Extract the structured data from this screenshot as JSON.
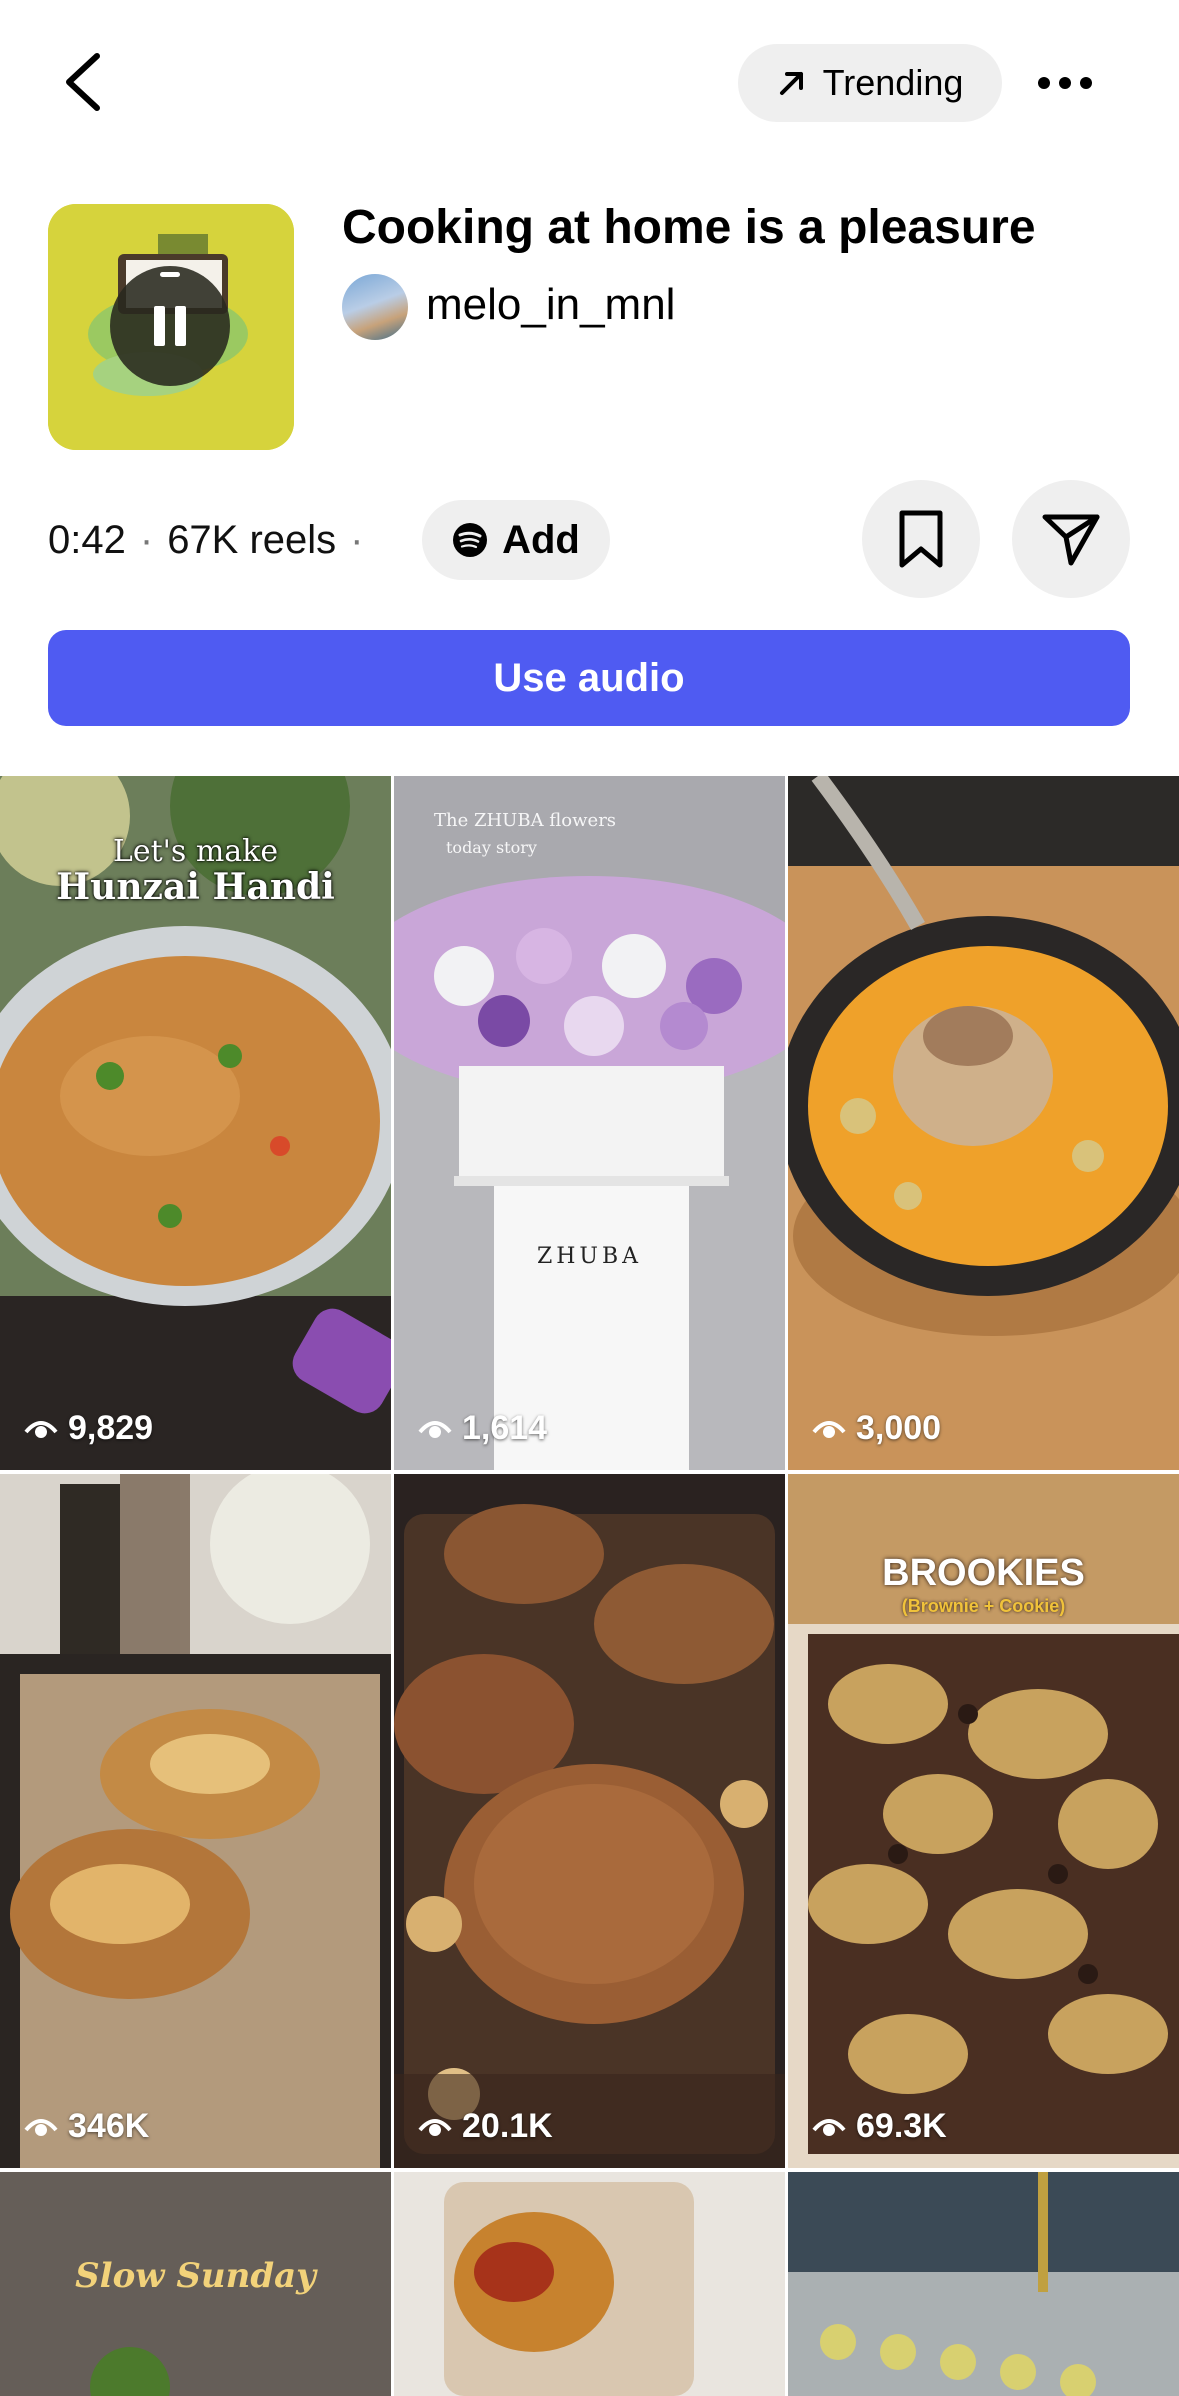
{
  "header": {
    "trending_label": "Trending"
  },
  "audio": {
    "title": "Cooking at home is a pleasure",
    "author": "melo_in_mnl",
    "duration": "0:42",
    "reels_count": "67K reels",
    "add_label": "Add",
    "use_audio_label": "Use audio"
  },
  "colors": {
    "accent": "#4f5bf2",
    "pill_bg": "#efefef"
  },
  "reels": [
    {
      "views": "9,829",
      "overlay_line1": "Let's make",
      "overlay_line2": "Hunzai Handi"
    },
    {
      "views": "1,614",
      "overlay_line1": "The ZHUBA flowers",
      "overlay_line2": "today story",
      "box_text": "ZHUBA"
    },
    {
      "views": "3,000"
    },
    {
      "views": "346K"
    },
    {
      "views": "20.1K"
    },
    {
      "views": "69.3K",
      "overlay_line1": "BROOKIES",
      "overlay_line2": "(Brownie + Cookie)"
    },
    {
      "overlay_line1": "Slow Sunday"
    },
    {},
    {}
  ]
}
